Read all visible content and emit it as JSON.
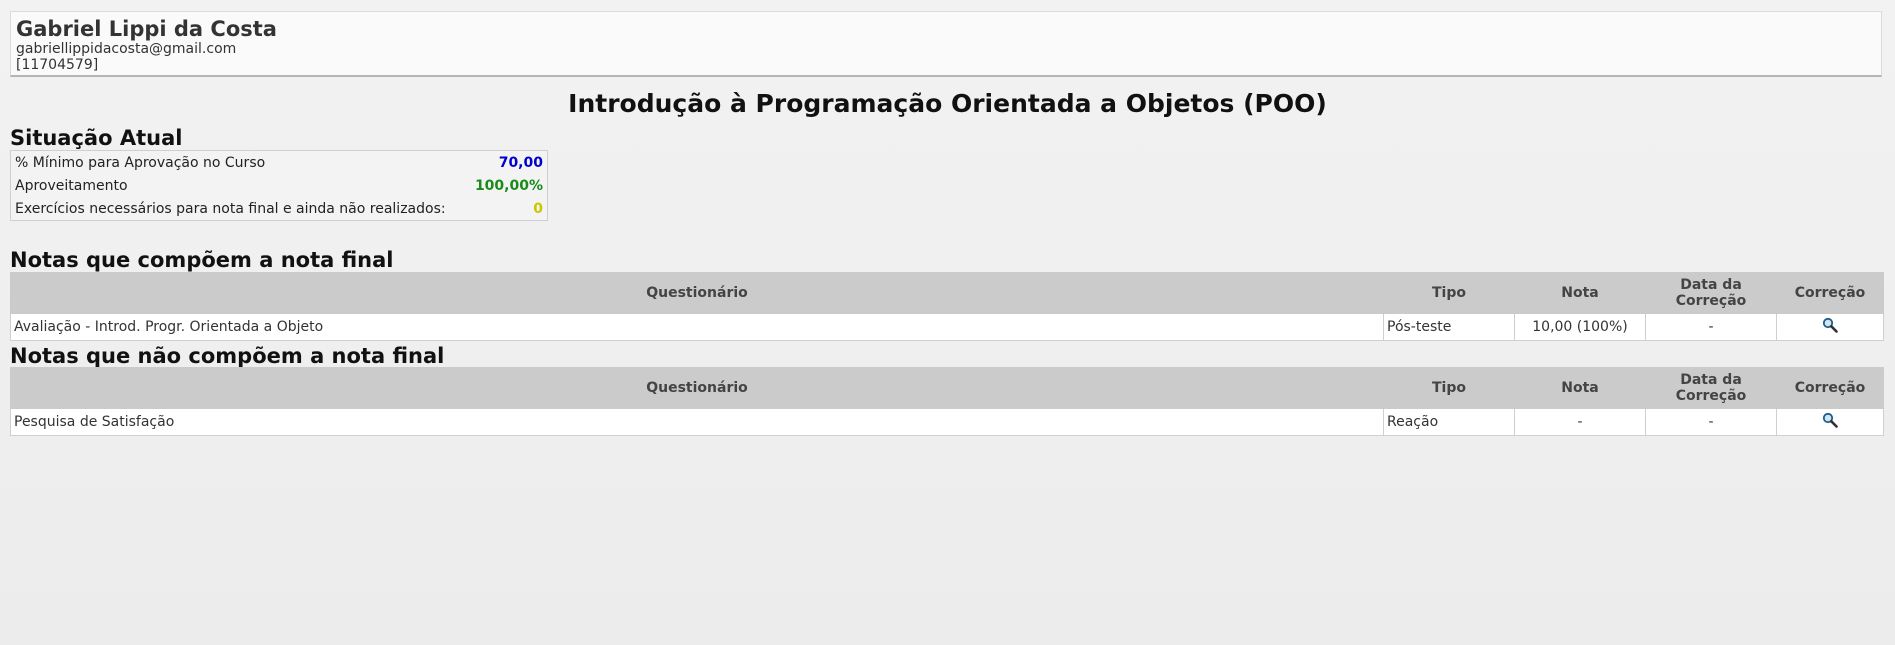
{
  "user": {
    "name": "Gabriel Lippi da Costa",
    "email": "gabriellippidacosta@gmail.com",
    "id": "[11704579]"
  },
  "course_title": "Introdução à Programação Orientada a Objetos (POO)",
  "status": {
    "title": "Situação Atual",
    "rows": [
      {
        "label": "% Mínimo para Aprovação no Curso",
        "value": "70,00",
        "color": "#0000cc"
      },
      {
        "label": "Aproveitamento",
        "value": "100,00%",
        "color": "#1a8a1a"
      },
      {
        "label": "Exercícios necessários para nota final e ainda não realizados:",
        "value": "0",
        "color": "#c8c800"
      }
    ]
  },
  "headers": {
    "questionario": "Questionário",
    "tipo": "Tipo",
    "nota": "Nota",
    "data_line1": "Data da",
    "data_line2": "Correção",
    "correcao": "Correção"
  },
  "final_grades": {
    "title": "Notas que compõem a nota final",
    "rows": [
      {
        "questionario": "Avaliação - Introd. Progr. Orientada a Objeto",
        "tipo": "Pós-teste",
        "nota": "10,00 (100%)",
        "data": "-",
        "correcao_icon": "magnifier-icon"
      }
    ]
  },
  "non_final_grades": {
    "title": "Notas que não compõem a nota final",
    "rows": [
      {
        "questionario": "Pesquisa de Satisfação",
        "tipo": "Reação",
        "nota": "-",
        "data": "-",
        "correcao_icon": "magnifier-icon"
      }
    ]
  }
}
